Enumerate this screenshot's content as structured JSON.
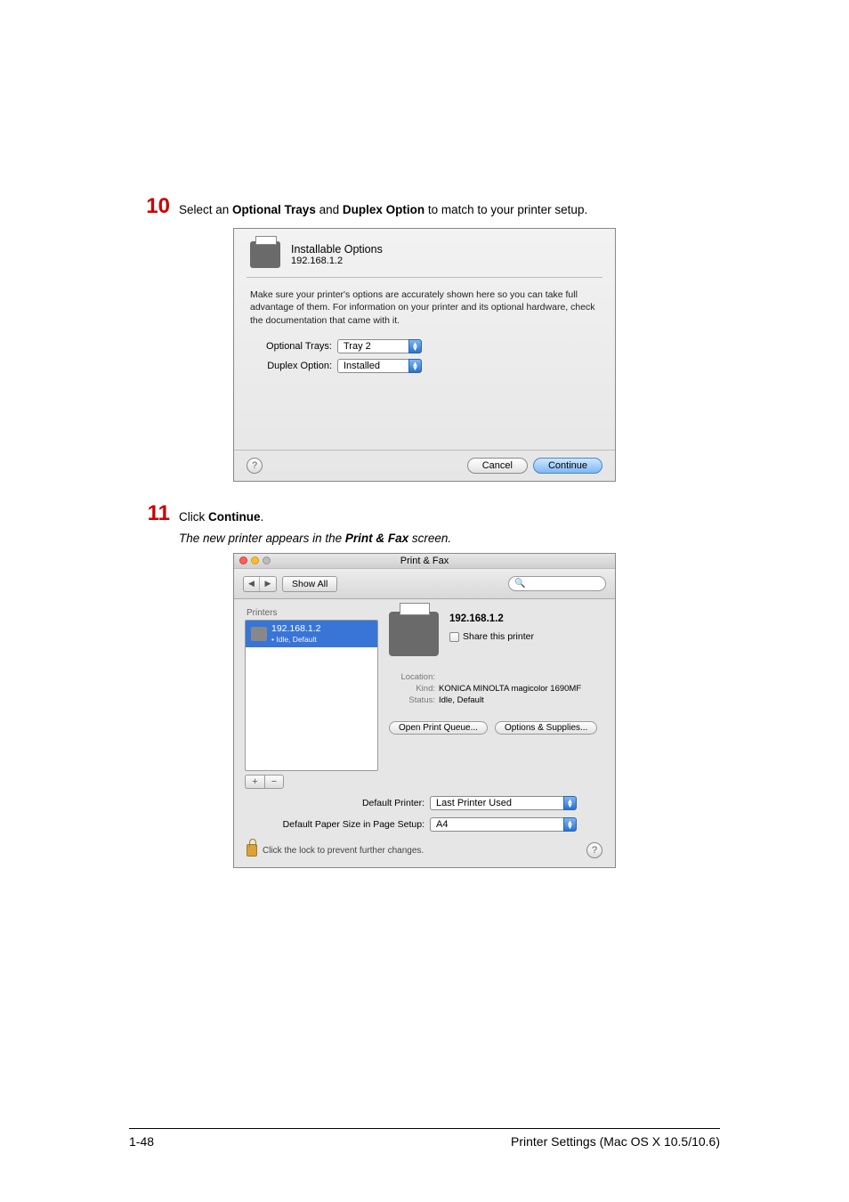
{
  "step10": {
    "num": "10",
    "text_prefix": "Select an ",
    "b1": "Optional Trays",
    "text_mid": " and ",
    "b2": "Duplex Option",
    "text_suffix": " to match to your printer setup."
  },
  "dialog1": {
    "title": "Installable Options",
    "subtitle": "192.168.1.2",
    "note": "Make sure your printer's options are accurately shown here so you can take full advantage of them.  For information on your printer and its optional hardware, check the documentation that came with it.",
    "rows": {
      "trays": {
        "label": "Optional Trays:",
        "value": "Tray 2"
      },
      "duplex": {
        "label": "Duplex Option:",
        "value": "Installed"
      }
    },
    "help": "?",
    "cancel": "Cancel",
    "continue": "Continue"
  },
  "step11": {
    "num": "11",
    "text_prefix": "Click ",
    "b1": "Continue",
    "dot": ".",
    "caption_prefix": "The new printer appears in the ",
    "caption_b": "Print & Fax",
    "caption_suffix": " screen."
  },
  "dialog2": {
    "title": "Print & Fax",
    "back": "◀",
    "fwd": "▶",
    "showall": "Show All",
    "printers_hdr": "Printers",
    "list": {
      "name": "192.168.1.2",
      "status_bullet": "• Idle, Default"
    },
    "plus": "+",
    "minus": "−",
    "pname": "192.168.1.2",
    "share": "Share this printer",
    "loc_k": "Location:",
    "loc_v": "",
    "kind_k": "Kind:",
    "kind_v": "KONICA MINOLTA magicolor 1690MF",
    "status_k": "Status:",
    "status_v": "Idle, Default",
    "open_q": "Open Print Queue...",
    "opts": "Options & Supplies...",
    "def_printer_lbl": "Default Printer:",
    "def_printer_val": "Last Printer Used",
    "def_paper_lbl": "Default Paper Size in Page Setup:",
    "def_paper_val": "A4",
    "lock": "Click the lock to prevent further changes.",
    "help": "?"
  },
  "footer": {
    "left": "1-48",
    "right": "Printer Settings (Mac OS X 10.5/10.6)"
  }
}
